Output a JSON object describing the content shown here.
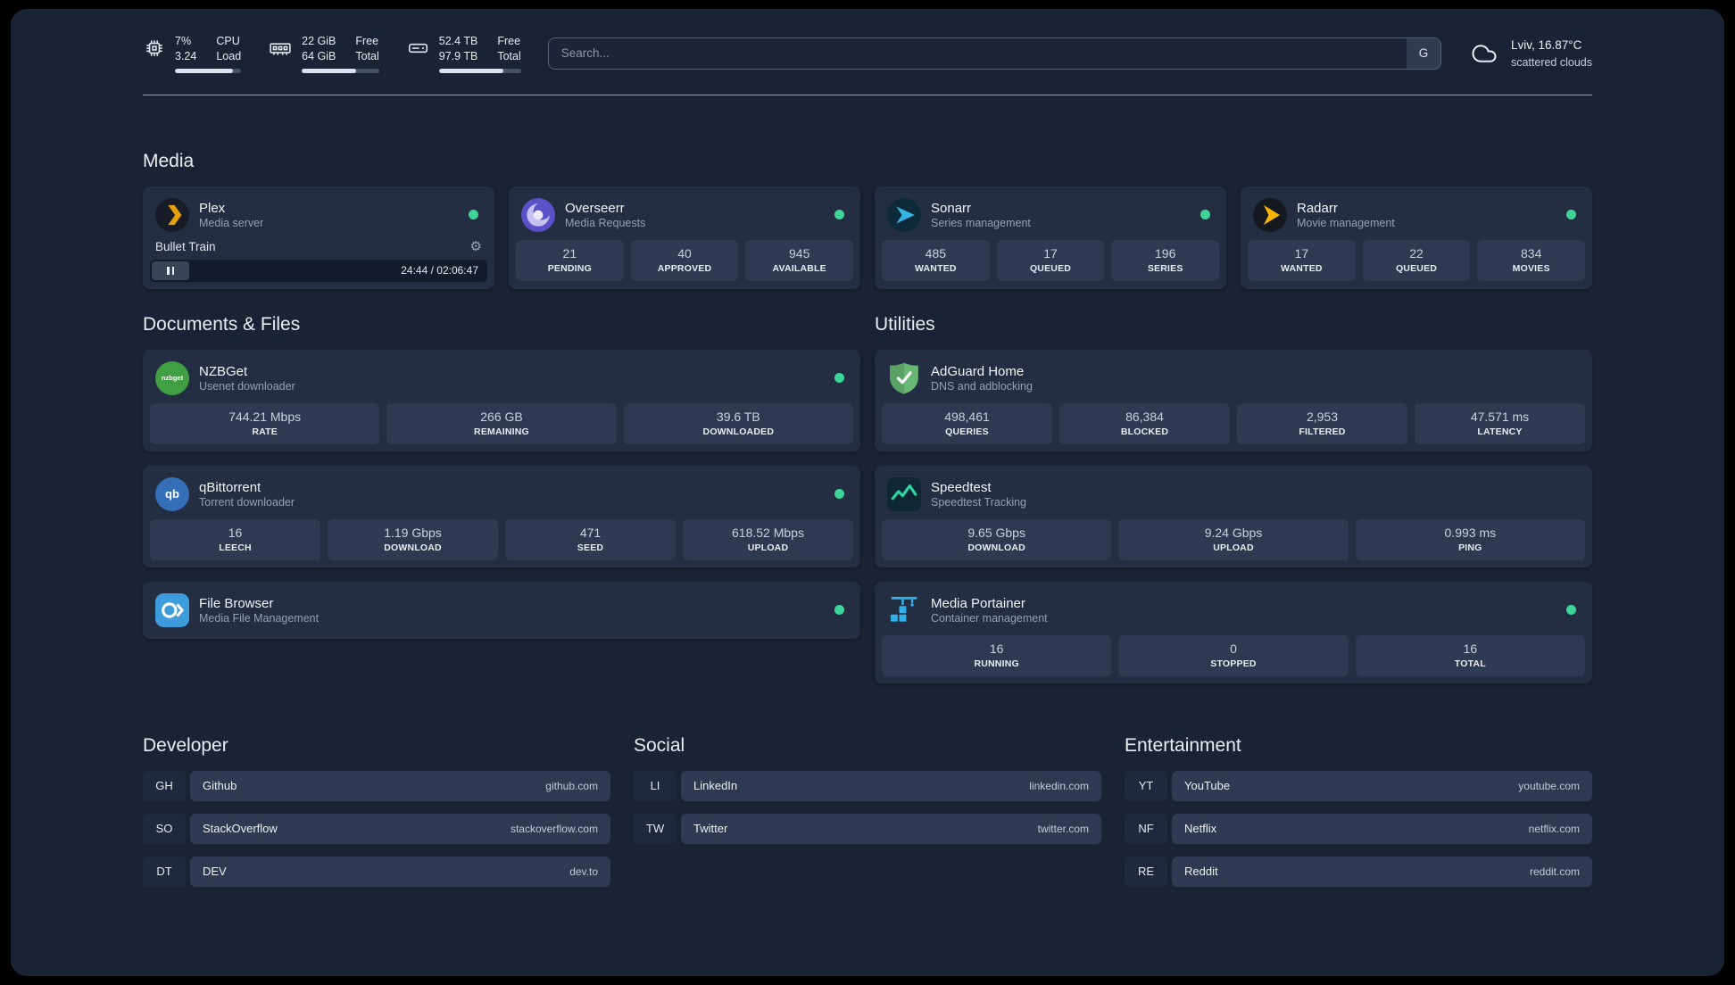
{
  "topbar": {
    "cpu": {
      "value_top": "7%",
      "value_bottom": "3.24",
      "label_top": "CPU",
      "label_bottom": "Load",
      "bar_percent": 88
    },
    "memory": {
      "value_top": "22 GiB",
      "value_bottom": "64 GiB",
      "label_top": "Free",
      "label_bottom": "Total",
      "bar_percent": 70
    },
    "disk": {
      "value_top": "52.4 TB",
      "value_bottom": "97.9 TB",
      "label_top": "Free",
      "label_bottom": "Total",
      "bar_percent": 78
    },
    "search": {
      "placeholder": "Search...",
      "provider_label": "G"
    },
    "weather": {
      "location": "Lviv, 16.87°C",
      "condition": "scattered clouds"
    }
  },
  "media": {
    "title": "Media",
    "plex": {
      "name": "Plex",
      "subtitle": "Media server",
      "now_playing": "Bullet Train",
      "time": "24:44 / 02:06:47"
    },
    "overseerr": {
      "name": "Overseerr",
      "subtitle": "Media Requests",
      "stats": [
        {
          "value": "21",
          "label": "PENDING"
        },
        {
          "value": "40",
          "label": "APPROVED"
        },
        {
          "value": "945",
          "label": "AVAILABLE"
        }
      ]
    },
    "sonarr": {
      "name": "Sonarr",
      "subtitle": "Series management",
      "stats": [
        {
          "value": "485",
          "label": "WANTED"
        },
        {
          "value": "17",
          "label": "QUEUED"
        },
        {
          "value": "196",
          "label": "SERIES"
        }
      ]
    },
    "radarr": {
      "name": "Radarr",
      "subtitle": "Movie management",
      "stats": [
        {
          "value": "17",
          "label": "WANTED"
        },
        {
          "value": "22",
          "label": "QUEUED"
        },
        {
          "value": "834",
          "label": "MOVIES"
        }
      ]
    }
  },
  "documents": {
    "title": "Documents & Files",
    "nzbget": {
      "name": "NZBGet",
      "subtitle": "Usenet downloader",
      "icon_text": "nzbget",
      "stats": [
        {
          "value": "744.21 Mbps",
          "label": "RATE"
        },
        {
          "value": "266 GB",
          "label": "REMAINING"
        },
        {
          "value": "39.6 TB",
          "label": "DOWNLOADED"
        }
      ]
    },
    "qbittorrent": {
      "name": "qBittorrent",
      "subtitle": "Torrent downloader",
      "icon_text": "qb",
      "stats": [
        {
          "value": "16",
          "label": "LEECH"
        },
        {
          "value": "1.19 Gbps",
          "label": "DOWNLOAD"
        },
        {
          "value": "471",
          "label": "SEED"
        },
        {
          "value": "618.52 Mbps",
          "label": "UPLOAD"
        }
      ]
    },
    "filebrowser": {
      "name": "File Browser",
      "subtitle": "Media File Management"
    }
  },
  "utilities": {
    "title": "Utilities",
    "adguard": {
      "name": "AdGuard Home",
      "subtitle": "DNS and adblocking",
      "stats": [
        {
          "value": "498,461",
          "label": "QUERIES"
        },
        {
          "value": "86,384",
          "label": "BLOCKED"
        },
        {
          "value": "2,953",
          "label": "FILTERED"
        },
        {
          "value": "47.571 ms",
          "label": "LATENCY"
        }
      ]
    },
    "speedtest": {
      "name": "Speedtest",
      "subtitle": "Speedtest Tracking",
      "stats": [
        {
          "value": "9.65 Gbps",
          "label": "DOWNLOAD"
        },
        {
          "value": "9.24 Gbps",
          "label": "UPLOAD"
        },
        {
          "value": "0.993 ms",
          "label": "PING"
        }
      ]
    },
    "portainer": {
      "name": "Media Portainer",
      "subtitle": "Container management",
      "stats": [
        {
          "value": "16",
          "label": "RUNNING"
        },
        {
          "value": "0",
          "label": "STOPPED"
        },
        {
          "value": "16",
          "label": "TOTAL"
        }
      ]
    }
  },
  "bookmarks": [
    {
      "title": "Developer",
      "items": [
        {
          "abbr": "GH",
          "name": "Github",
          "url": "github.com"
        },
        {
          "abbr": "SO",
          "name": "StackOverflow",
          "url": "stackoverflow.com"
        },
        {
          "abbr": "DT",
          "name": "DEV",
          "url": "dev.to"
        }
      ]
    },
    {
      "title": "Social",
      "items": [
        {
          "abbr": "LI",
          "name": "LinkedIn",
          "url": "linkedin.com"
        },
        {
          "abbr": "TW",
          "name": "Twitter",
          "url": "twitter.com"
        }
      ]
    },
    {
      "title": "Entertainment",
      "items": [
        {
          "abbr": "YT",
          "name": "YouTube",
          "url": "youtube.com"
        },
        {
          "abbr": "NF",
          "name": "Netflix",
          "url": "netflix.com"
        },
        {
          "abbr": "RE",
          "name": "Reddit",
          "url": "reddit.com"
        }
      ]
    }
  ],
  "colors": {
    "status_online": "#3ed598",
    "plex_accent": "#e5a00d",
    "overseerr_purple": "#5a51c8",
    "sonarr_blue": "#35b5e5",
    "radarr_yellow": "#f7b500",
    "nzbget_green": "#3f9f42",
    "qbittorrent_blue": "#356fb8",
    "adguard_green": "#68b774",
    "speedtest_green": "#2dd4a0",
    "filebrowser_blue": "#3d9cdb",
    "portainer_blue": "#2fb0e8"
  }
}
